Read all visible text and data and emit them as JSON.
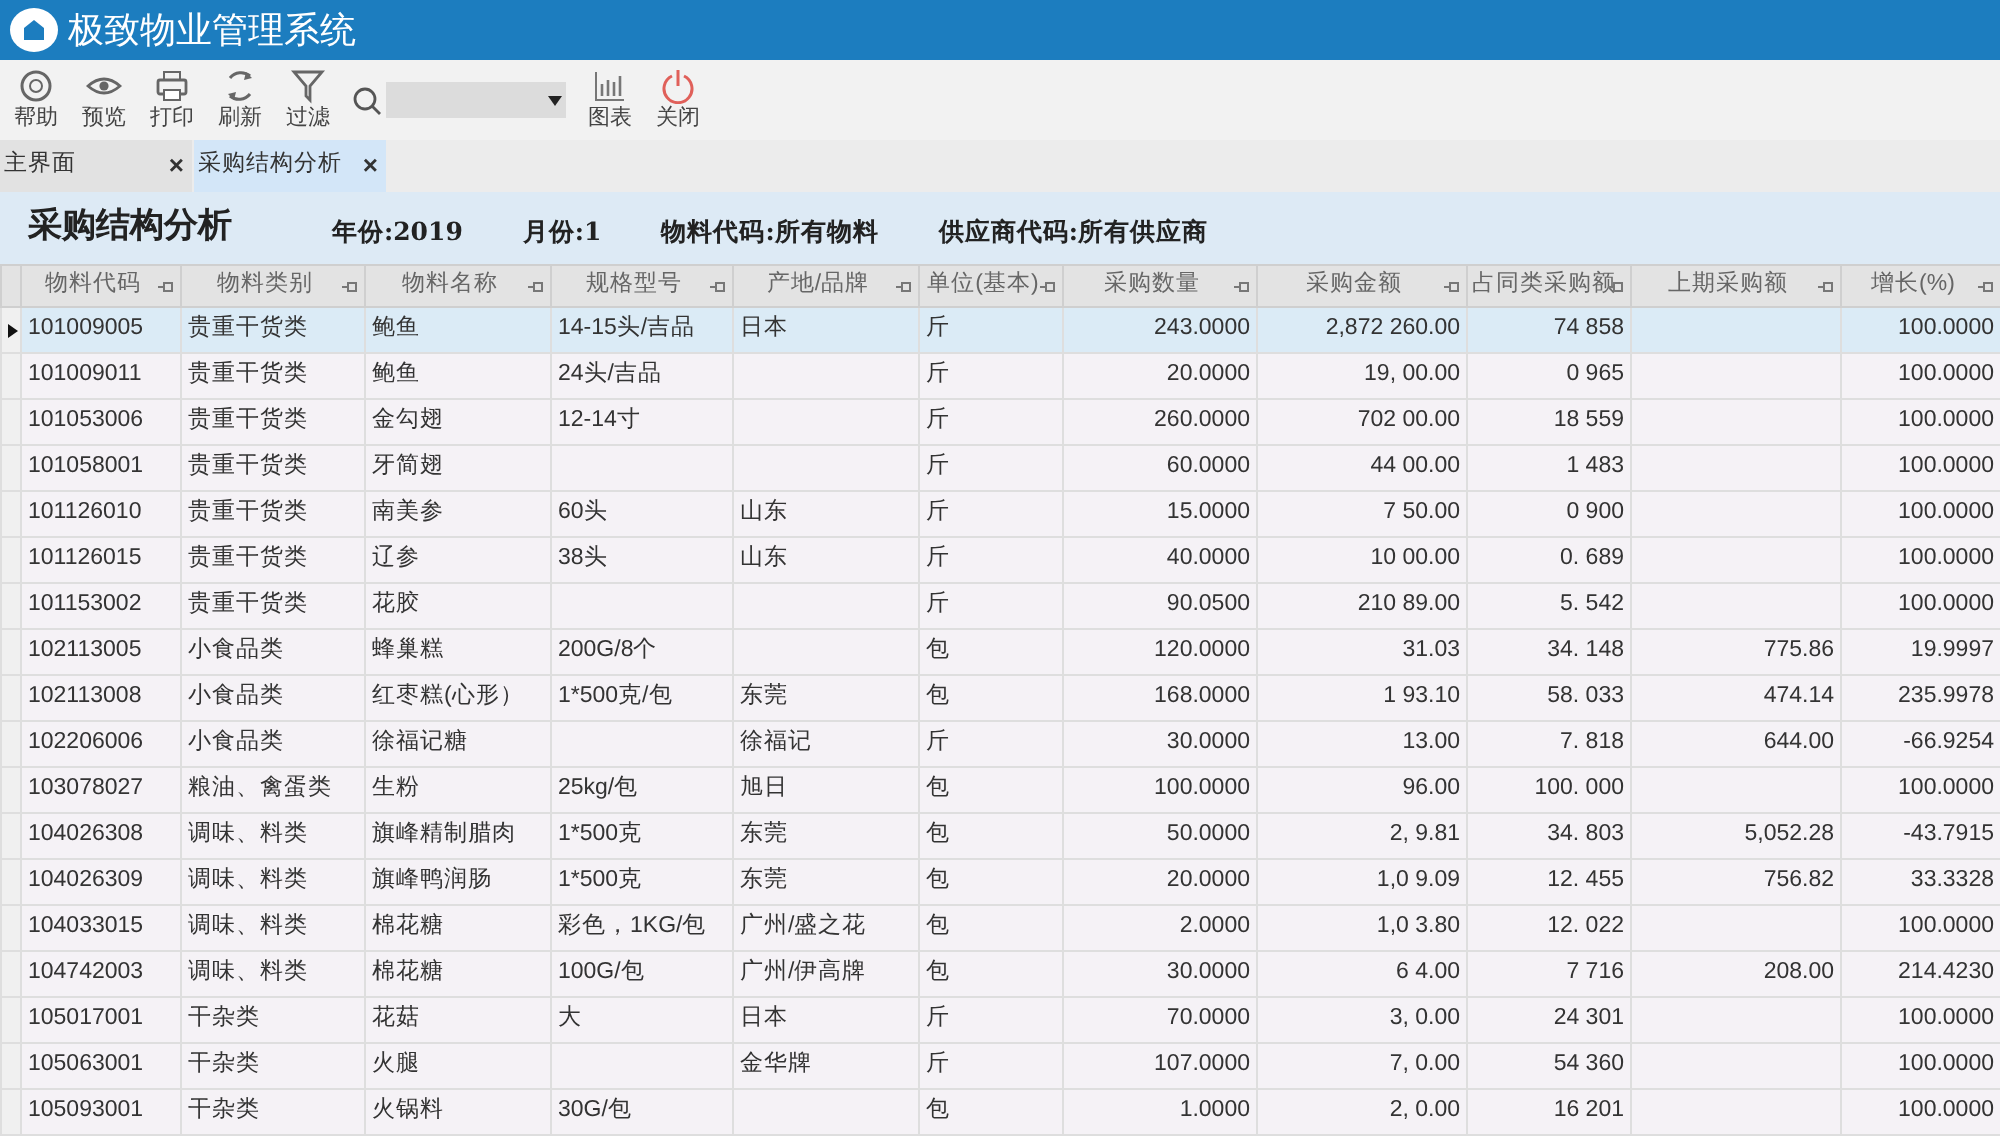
{
  "window": {
    "title": "极致物业管理系统"
  },
  "toolbar": [
    {
      "kind": "help",
      "label": "帮助"
    },
    {
      "kind": "preview",
      "label": "预览"
    },
    {
      "kind": "print",
      "label": "打印"
    },
    {
      "kind": "refresh",
      "label": "刷新"
    },
    {
      "kind": "filter",
      "label": "过滤"
    },
    {
      "kind": "search"
    },
    {
      "kind": "chart",
      "label": "图表"
    },
    {
      "kind": "power",
      "label": "关闭"
    }
  ],
  "tabs": [
    {
      "label": "主界面",
      "close": "×",
      "selected": false
    },
    {
      "label": "采购结构分析",
      "close": "×",
      "selected": true
    }
  ],
  "report": {
    "title": "采购结构分析",
    "filters": [
      "年份:2019",
      "月份:1",
      "物料代码:所有物料",
      "供应商代码:所有供应商"
    ]
  },
  "table": {
    "columns": [
      "物料代码",
      "物料类别",
      "物料名称",
      "规格型号",
      "产地/品牌",
      "单位(基本)",
      "采购数量",
      "采购金额",
      "占同类采购额",
      "上期采购额",
      "增长(%)"
    ],
    "rows": [
      {
        "selected": true,
        "cells": [
          "101009005",
          "贵重干货类",
          "鲍鱼",
          "14-15头/吉品",
          "日本",
          "斤",
          "243.0000",
          "2,872 260.00",
          "74 858",
          "",
          "100.0000"
        ]
      },
      {
        "selected": false,
        "cells": [
          "101009011",
          "贵重干货类",
          "鲍鱼",
          "24头/吉品",
          "",
          "斤",
          "20.0000",
          "19, 00.00",
          "0 965",
          "",
          "100.0000"
        ]
      },
      {
        "selected": false,
        "cells": [
          "101053006",
          "贵重干货类",
          "金勾翅",
          "12-14寸",
          "",
          "斤",
          "260.0000",
          "702 00.00",
          "18 559",
          "",
          "100.0000"
        ]
      },
      {
        "selected": false,
        "cells": [
          "101058001",
          "贵重干货类",
          "牙简翅",
          "",
          "",
          "斤",
          "60.0000",
          "44 00.00",
          "1 483",
          "",
          "100.0000"
        ]
      },
      {
        "selected": false,
        "cells": [
          "101126010",
          "贵重干货类",
          "南美参",
          "60头",
          "山东",
          "斤",
          "15.0000",
          "7 50.00",
          "0 900",
          "",
          "100.0000"
        ]
      },
      {
        "selected": false,
        "cells": [
          "101126015",
          "贵重干货类",
          "辽参",
          "38头",
          "山东",
          "斤",
          "40.0000",
          "10 00.00",
          "0. 689",
          "",
          "100.0000"
        ]
      },
      {
        "selected": false,
        "cells": [
          "101153002",
          "贵重干货类",
          "花胶",
          "",
          "",
          "斤",
          "90.0500",
          "210 89.00",
          "5. 542",
          "",
          "100.0000"
        ]
      },
      {
        "selected": false,
        "cells": [
          "102113005",
          "小食品类",
          "蜂巢糕",
          "200G/8个",
          "",
          "包",
          "120.0000",
          "31.03",
          "34. 148",
          "775.86",
          "19.9997"
        ]
      },
      {
        "selected": false,
        "cells": [
          "102113008",
          "小食品类",
          "红枣糕(心形）",
          "1*500克/包",
          "东莞",
          "包",
          "168.0000",
          "1 93.10",
          "58. 033",
          "474.14",
          "235.9978"
        ]
      },
      {
        "selected": false,
        "cells": [
          "102206006",
          "小食品类",
          "徐福记糖",
          "",
          "徐福记",
          "斤",
          "30.0000",
          "13.00",
          "7. 818",
          "644.00",
          "-66.9254"
        ]
      },
      {
        "selected": false,
        "cells": [
          "103078027",
          "粮油、禽蛋类",
          "生粉",
          "25kg/包",
          "旭日",
          "包",
          "100.0000",
          "96.00",
          "100. 000",
          "",
          "100.0000"
        ]
      },
      {
        "selected": false,
        "cells": [
          "104026308",
          "调味、料类",
          "旗峰精制腊肉",
          "1*500克",
          "东莞",
          "包",
          "50.0000",
          "2, 9.81",
          "34. 803",
          "5,052.28",
          "-43.7915"
        ]
      },
      {
        "selected": false,
        "cells": [
          "104026309",
          "调味、料类",
          "旗峰鸭润肠",
          "1*500克",
          "东莞",
          "包",
          "20.0000",
          "1,0 9.09",
          "12. 455",
          "756.82",
          "33.3328"
        ]
      },
      {
        "selected": false,
        "cells": [
          "104033015",
          "调味、料类",
          "棉花糖",
          "彩色，1KG/包",
          "广州/盛之花",
          "包",
          "2.0000",
          "1,0 3.80",
          "12. 022",
          "",
          "100.0000"
        ]
      },
      {
        "selected": false,
        "cells": [
          "104742003",
          "调味、料类",
          "棉花糖",
          "100G/包",
          "广州/伊高牌",
          "包",
          "30.0000",
          "6 4.00",
          "7 716",
          "208.00",
          "214.4230"
        ]
      },
      {
        "selected": false,
        "cells": [
          "105017001",
          "干杂类",
          "花菇",
          "大",
          "日本",
          "斤",
          "70.0000",
          "3, 0.00",
          "24 301",
          "",
          "100.0000"
        ]
      },
      {
        "selected": false,
        "cells": [
          "105063001",
          "干杂类",
          "火腿",
          "",
          "金华牌",
          "斤",
          "107.0000",
          "7, 0.00",
          "54 360",
          "",
          "100.0000"
        ]
      },
      {
        "selected": false,
        "cells": [
          "105093001",
          "干杂类",
          "火锅料",
          "30G/包",
          "",
          "包",
          "1.0000",
          "2, 0.00",
          "16 201",
          "",
          "100.0000"
        ]
      }
    ]
  }
}
